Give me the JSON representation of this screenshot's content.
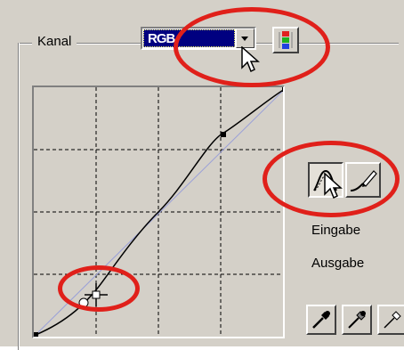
{
  "channel": {
    "label": "Kanal",
    "selected": "RGB"
  },
  "curve_panel": {
    "input_label": "Eingabe",
    "output_label": "Ausgabe"
  },
  "colors": {
    "highlight_ring": "#e0201a",
    "selection": "#000080",
    "dialog_bg": "#d4d0c8"
  },
  "icons": {
    "dropdown": "chevron-down-icon",
    "channel_display": "rgb-channels-icon",
    "curve_tool": "curve-point-icon",
    "freehand_tool": "freehand-pencil-icon",
    "eyedroppers": [
      "black-point-eyedropper-icon",
      "gray-point-eyedropper-icon",
      "white-point-eyedropper-icon"
    ]
  }
}
